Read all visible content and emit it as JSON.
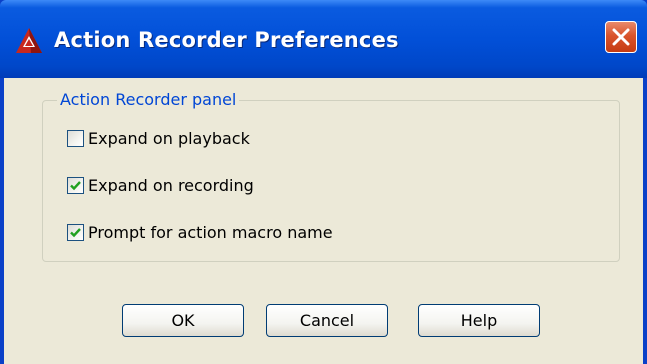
{
  "window": {
    "title": "Action Recorder Preferences",
    "icon": "autocad-icon",
    "close_icon": "close-icon",
    "colors": {
      "titlebar": "#0250d8",
      "close_button": "#d9542c",
      "dialog_background": "#ece9d8",
      "group_title": "#0046d5",
      "checkmark": "#21a121"
    }
  },
  "group": {
    "title": "Action Recorder panel",
    "options": [
      {
        "label": "Expand on playback",
        "checked": false
      },
      {
        "label": "Expand on recording",
        "checked": true
      },
      {
        "label": "Prompt for action macro name",
        "checked": true
      }
    ]
  },
  "buttons": {
    "ok_label": "OK",
    "cancel_label": "Cancel",
    "help_label": "Help"
  }
}
